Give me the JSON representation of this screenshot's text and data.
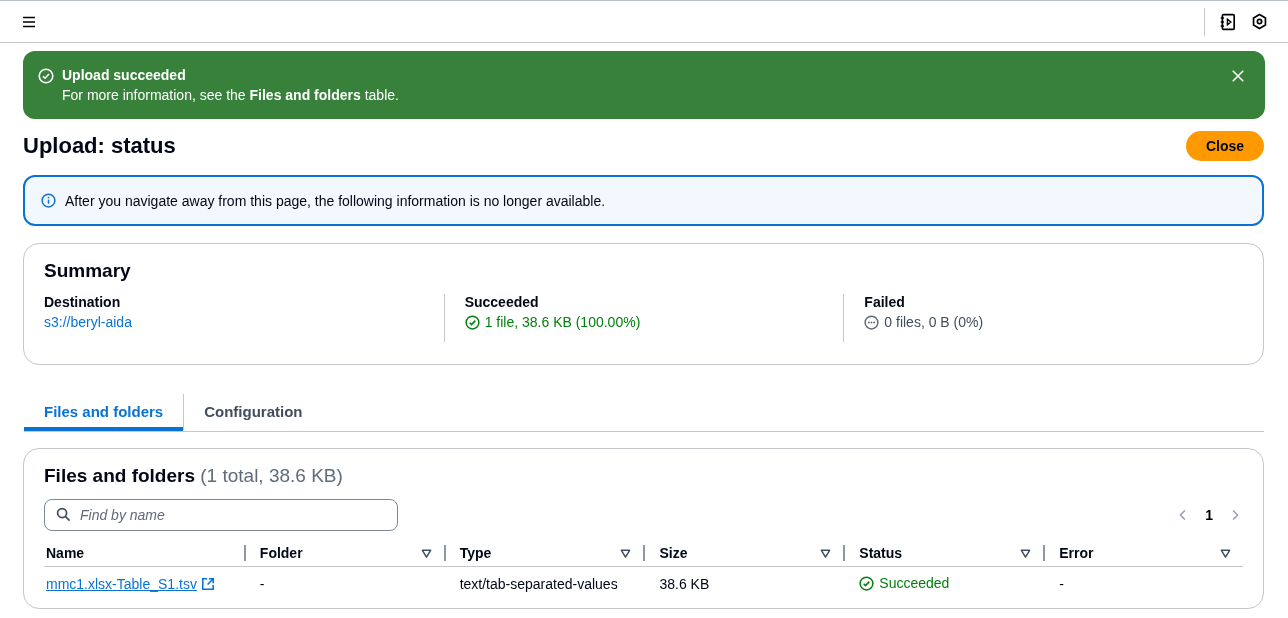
{
  "flash": {
    "title": "Upload succeeded",
    "message": "For more information, see the **Files and folders** table."
  },
  "page_title": "Upload: status",
  "close_button": "Close",
  "info_alert": "After you navigate away from this page, the following information is no longer available.",
  "summary": {
    "title": "Summary",
    "items": [
      {
        "kind": "link",
        "label": "Destination",
        "value": "s3://beryl-aida"
      },
      {
        "kind": "success",
        "label": "Succeeded",
        "value": "1 file, 38.6 KB (100.00%)"
      },
      {
        "kind": "pending",
        "label": "Failed",
        "value": "0 files, 0 B (0%)"
      }
    ]
  },
  "tabs": [
    {
      "label": "Files and folders",
      "selected": true
    },
    {
      "label": "Configuration",
      "selected": false
    }
  ],
  "files_table": {
    "title": "Files and folders",
    "count": "(1 total, 38.6 KB)",
    "search": {
      "placeholder": "Find by name"
    },
    "page": "1",
    "columns": [
      {
        "label": "Name",
        "sortable": false
      },
      {
        "label": "Folder",
        "sortable": true
      },
      {
        "label": "Type",
        "sortable": true
      },
      {
        "label": "Size",
        "sortable": true
      },
      {
        "label": "Status",
        "sortable": true
      },
      {
        "label": "Error",
        "sortable": true
      }
    ],
    "rows": [
      {
        "name": "mmc1.xlsx-Table_S1.tsv",
        "folder": "-",
        "type": "text/tab-separated-values",
        "size": "38.6 KB",
        "status": "Succeeded",
        "error": "-"
      }
    ]
  }
}
